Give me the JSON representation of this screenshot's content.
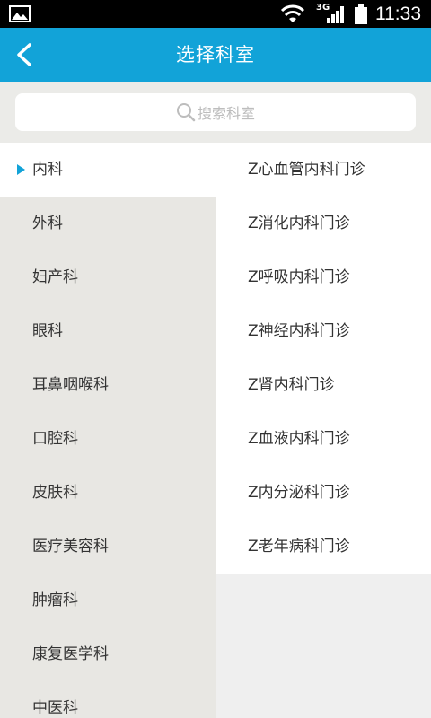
{
  "status_bar": {
    "network_label": "3G",
    "time": "11:33",
    "icons": [
      "gallery-icon",
      "wifi-icon",
      "signal-icon",
      "battery-icon"
    ]
  },
  "app_bar": {
    "title": "选择科室",
    "back_icon": "back-arrow-icon"
  },
  "search": {
    "placeholder": "搜索科室",
    "icon": "search-icon"
  },
  "colors": {
    "accent": "#12a3d8",
    "left_panel_bg": "#e8e7e3",
    "selected_bg": "#ffffff"
  },
  "departments": [
    {
      "label": "内科",
      "selected": true
    },
    {
      "label": "外科"
    },
    {
      "label": "妇产科"
    },
    {
      "label": "眼科"
    },
    {
      "label": "耳鼻咽喉科"
    },
    {
      "label": "口腔科"
    },
    {
      "label": "皮肤科"
    },
    {
      "label": "医疗美容科"
    },
    {
      "label": "肿瘤科"
    },
    {
      "label": "康复医学科"
    },
    {
      "label": "中医科"
    }
  ],
  "clinics": [
    {
      "label": "Z心血管内科门诊"
    },
    {
      "label": "Z消化内科门诊"
    },
    {
      "label": "Z呼吸内科门诊"
    },
    {
      "label": "Z神经内科门诊"
    },
    {
      "label": "Z肾内科门诊"
    },
    {
      "label": "Z血液内科门诊"
    },
    {
      "label": "Z内分泌科门诊"
    },
    {
      "label": "Z老年病科门诊"
    }
  ]
}
